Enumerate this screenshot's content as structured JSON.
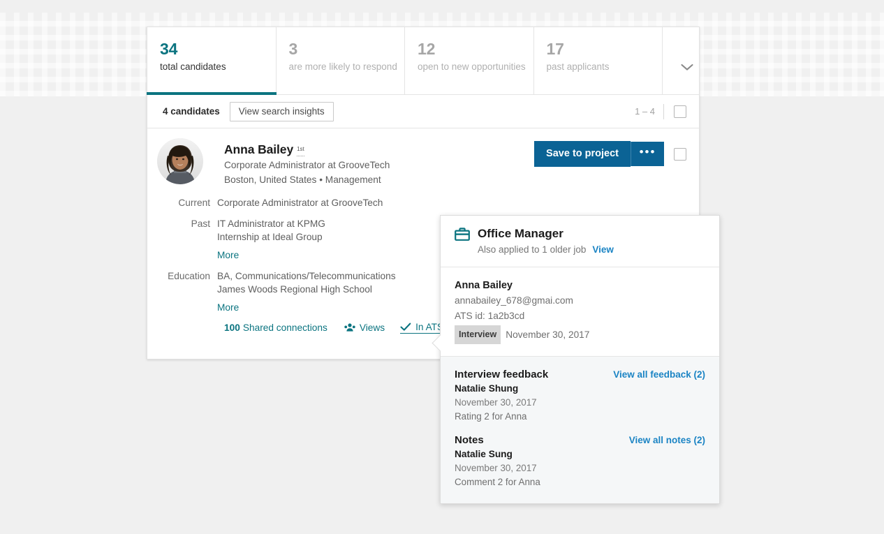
{
  "facets": [
    {
      "number": "34",
      "label": "total candidates",
      "active": true
    },
    {
      "number": "3",
      "label": "are more likely to respond",
      "active": false
    },
    {
      "number": "12",
      "label": "open to new opportunities",
      "active": false
    },
    {
      "number": "17",
      "label": "past applicants",
      "active": false
    }
  ],
  "facet_expand_icon": "chevron-down-icon",
  "count_bar": {
    "count_label": "4 candidates",
    "insights_button": "View search insights",
    "pager_range": "1 – 4"
  },
  "candidate": {
    "name": "Anna Bailey",
    "degree": "1st",
    "headline": "Corporate Administrator at GrooveTech",
    "location_line": "Boston, United States • Management",
    "details": [
      {
        "key": "Current",
        "values": [
          "Corporate Administrator at GrooveTech"
        ],
        "more": null
      },
      {
        "key": "Past",
        "values": [
          "IT Administrator at KPMG",
          "Internship at Ideal Group"
        ],
        "more": "More"
      },
      {
        "key": "Education",
        "values": [
          "BA, Communications/Telecommunications",
          "James Woods Regional High School"
        ],
        "more": "More"
      }
    ],
    "shared_count": "100",
    "shared_text": "Shared connections",
    "views_label": "Views",
    "in_ats_label": "In ATS",
    "save_button": "Save to project",
    "more_actions": "•••"
  },
  "ats_popup": {
    "job_title": "Office Manager",
    "subline": "Also applied to 1 older job",
    "view_link": "View",
    "candidate_name": "Anna Bailey",
    "email": "annabailey_678@gmai.com",
    "ats_id": "ATS id: 1a2b3cd",
    "stage_badge": "Interview",
    "stage_date": "November 30, 2017",
    "feedback": {
      "title": "Interview feedback",
      "link": "View all feedback (2)",
      "author": "Natalie Shung",
      "date": "November 30, 2017",
      "body": "Rating 2 for Anna"
    },
    "notes": {
      "title": "Notes",
      "link": "View all notes (2)",
      "author": "Natalie Sung",
      "date": "November 30, 2017",
      "body": "Comment 2 for Anna"
    }
  },
  "colors": {
    "teal": "#0b7480",
    "blue": "#0b6395",
    "link_blue": "#1b84c4",
    "background": "#f0f0f0"
  }
}
